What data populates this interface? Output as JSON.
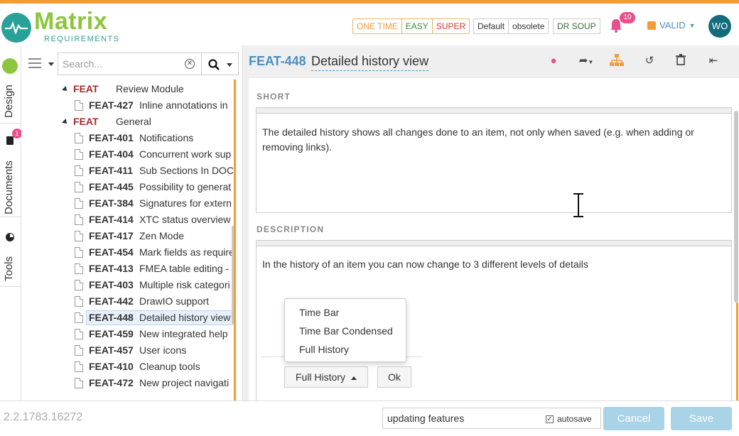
{
  "header": {
    "logo_word": "Matrix",
    "logo_sub": "REQUIREMENTS",
    "badge_groups": [
      [
        {
          "label": "ONE TIME",
          "color": "#f29b38"
        },
        {
          "label": "EASY",
          "color": "#3a8b3a"
        },
        {
          "label": "SUPER",
          "color": "#d9342b"
        }
      ],
      [
        {
          "label": "Default",
          "color": "#333333"
        },
        {
          "label": "obsolete",
          "color": "#333333"
        }
      ],
      [
        {
          "label": "DR SOUP",
          "color": "#3a6b3a"
        }
      ]
    ],
    "notification_count": "10",
    "status_label": "VALID",
    "user_initials": "WO"
  },
  "vtabs": {
    "design": "Design",
    "documents": "Documents",
    "documents_badge": "1",
    "tools": "Tools"
  },
  "tree": {
    "search_placeholder": "Search...",
    "rows": [
      {
        "type": "folder",
        "id": "FEAT",
        "title": "Review Module"
      },
      {
        "type": "item",
        "id": "FEAT-427",
        "title": "Inline annotations in"
      },
      {
        "type": "folder",
        "id": "FEAT",
        "title": "General"
      },
      {
        "type": "item",
        "id": "FEAT-401",
        "title": "Notifications"
      },
      {
        "type": "item",
        "id": "FEAT-404",
        "title": "Concurrent work sup"
      },
      {
        "type": "item",
        "id": "FEAT-411",
        "title": "Sub Sections In DOC"
      },
      {
        "type": "item",
        "id": "FEAT-445",
        "title": "Possibility to generat"
      },
      {
        "type": "item",
        "id": "FEAT-384",
        "title": "Signatures for extern"
      },
      {
        "type": "item",
        "id": "FEAT-414",
        "title": "XTC status overview"
      },
      {
        "type": "item",
        "id": "FEAT-417",
        "title": "Zen Mode"
      },
      {
        "type": "item",
        "id": "FEAT-454",
        "title": "Mark fields as require"
      },
      {
        "type": "item",
        "id": "FEAT-413",
        "title": "FMEA table editing -"
      },
      {
        "type": "item",
        "id": "FEAT-403",
        "title": "Multiple risk categori"
      },
      {
        "type": "item",
        "id": "FEAT-442",
        "title": "DrawIO support"
      },
      {
        "type": "item",
        "id": "FEAT-448",
        "title": "Detailed history view",
        "selected": true
      },
      {
        "type": "item",
        "id": "FEAT-459",
        "title": "New integrated help"
      },
      {
        "type": "item",
        "id": "FEAT-457",
        "title": "User icons"
      },
      {
        "type": "item",
        "id": "FEAT-410",
        "title": "Cleanup tools"
      },
      {
        "type": "item",
        "id": "FEAT-472",
        "title": "New project navigati"
      }
    ]
  },
  "item": {
    "id": "FEAT-448",
    "title": "Detailed history view",
    "short_label": "SHORT",
    "short_text": "The detailed history shows all changes done to an item, not only when saved (e.g. when adding or removing links).",
    "description_label": "DESCRIPTION",
    "description_text": "In the history of an item you can now change to 3 different levels of details",
    "dropdown_options": [
      "Time Bar",
      "Time Bar Condensed",
      "Full History"
    ],
    "selected_option": "Full History",
    "ok_label": "Ok"
  },
  "footer": {
    "version": "2.2.1783.16272",
    "comment_value": "updating features",
    "autosave_label": "autosave",
    "cancel_label": "Cancel",
    "save_label": "Save"
  }
}
